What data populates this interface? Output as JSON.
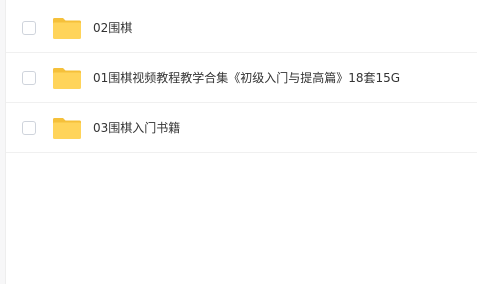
{
  "files": [
    {
      "name": "02围棋",
      "icon": "folder-icon"
    },
    {
      "name": "01围棋视频教程教学合集《初级入门与提高篇》18套15G",
      "icon": "folder-icon"
    },
    {
      "name": "03围棋入门书籍",
      "icon": "folder-icon"
    }
  ],
  "colors": {
    "folder": "#ffd45a",
    "folder_tab": "#f5c03a",
    "checkbox_border": "#cfd4dc",
    "divider": "#f0f0f0"
  }
}
